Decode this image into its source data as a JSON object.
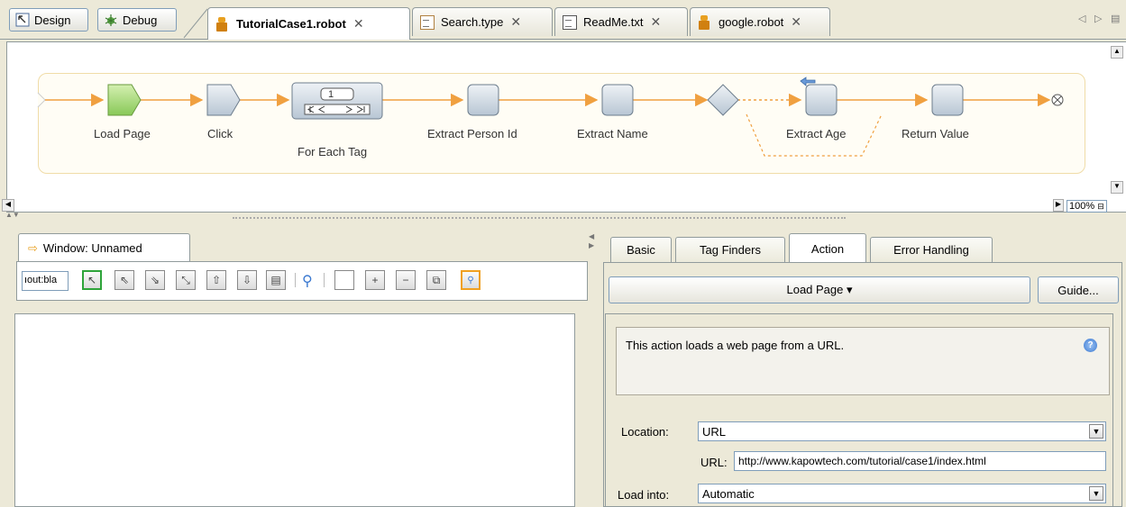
{
  "modes": [
    {
      "label": "Design",
      "icon": "design-icon"
    },
    {
      "label": "Debug",
      "icon": "debug-icon"
    }
  ],
  "tabs": [
    {
      "label": "TutorialCase1.robot",
      "icon": "robot-icon",
      "active": true
    },
    {
      "label": "Search.type",
      "icon": "type-icon"
    },
    {
      "label": "ReadMe.txt",
      "icon": "text-file-icon"
    },
    {
      "label": "google.robot",
      "icon": "robot-icon"
    }
  ],
  "flow": {
    "steps": [
      {
        "label": "Load Page"
      },
      {
        "label": "Click"
      },
      {
        "label": "For Each Tag",
        "counter": "1"
      },
      {
        "label": "Extract Person Id"
      },
      {
        "label": "Extract Name"
      },
      {
        "label": "Extract Age"
      },
      {
        "label": "Return Value"
      }
    ],
    "zoom": "100%"
  },
  "left_pane": {
    "window_tab": "Window: Unnamed",
    "address_value": "ıout:bla"
  },
  "right_pane": {
    "tabs": [
      "Basic",
      "Tag Finders",
      "Action",
      "Error Handling"
    ],
    "active_tab": "Action",
    "action_button": "Load Page ▾",
    "guide_button": "Guide...",
    "description": "This action loads a web page from a URL.",
    "location_label": "Location:",
    "location_value": "URL",
    "url_label": "URL:",
    "url_value": "http://www.kapowtech.com/tutorial/case1/index.html",
    "load_into_label": "Load into:",
    "load_into_value": "Automatic"
  },
  "colors": {
    "flow_line": "#f0a040",
    "step_fill": "#d3dde6",
    "start_fill": "#a8dc78",
    "accent_green": "#2ea43a",
    "accent_orange": "#f0a020"
  }
}
